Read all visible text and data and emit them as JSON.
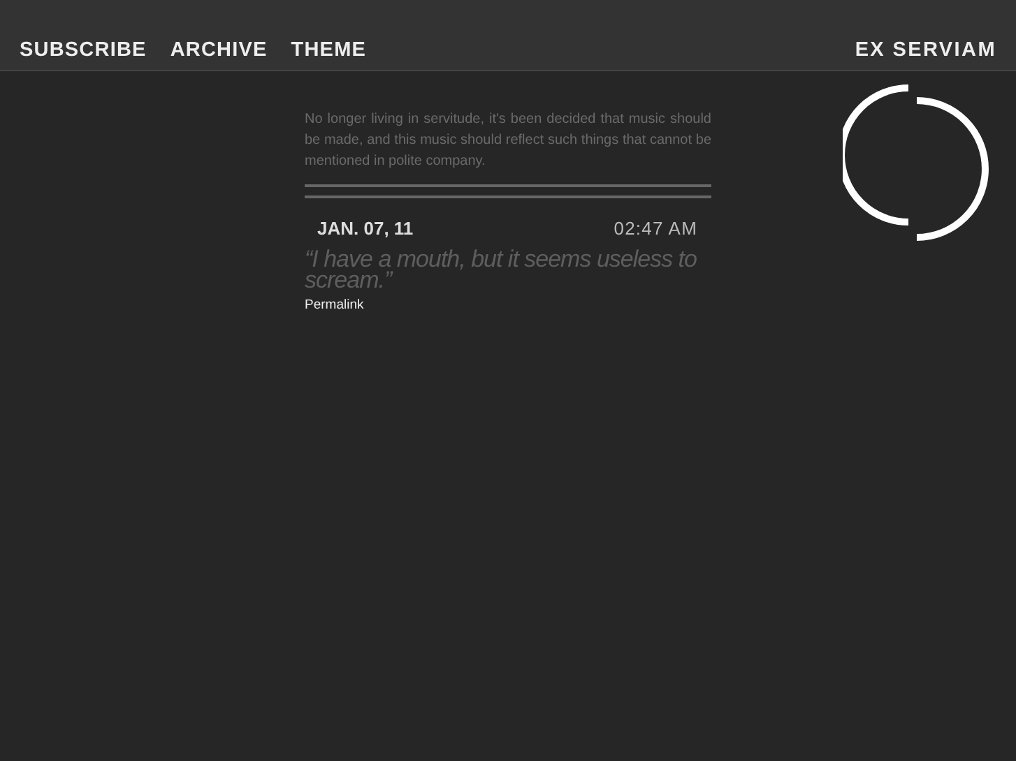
{
  "nav": [
    {
      "label": "SUBSCRIBE"
    },
    {
      "label": "ARCHIVE"
    },
    {
      "label": "THEME"
    }
  ],
  "site_title": "EX SERVIAM",
  "description": "No longer living in servitude, it's been decided that music should be made, and this music should reflect such things that cannot be mentioned in polite company.",
  "posts": [
    {
      "date": "JAN. 07, 11",
      "time": "02:47 AM",
      "quote": "“I have a mouth, but it seems useless to scream.”",
      "permalink": "Permalink"
    }
  ]
}
